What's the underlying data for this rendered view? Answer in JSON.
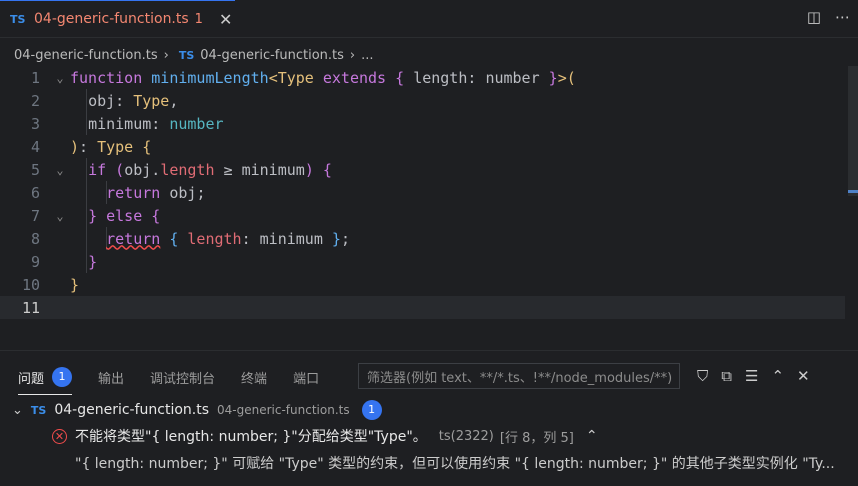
{
  "tab": {
    "badge": "TS",
    "title": "04-generic-function.ts",
    "count": "1",
    "close": "✕"
  },
  "actions": {
    "split": "◫",
    "more": "⋯"
  },
  "breadcrumb": {
    "file": "04-generic-function.ts",
    "sep": "›",
    "badge": "TS",
    "file2": "04-generic-function.ts",
    "ellipsis": "..."
  },
  "editor": {
    "lines": [
      "1",
      "2",
      "3",
      "4",
      "5",
      "6",
      "7",
      "8",
      "9",
      "10",
      "11"
    ],
    "fold": "⌄",
    "code": {
      "l1_kw": "function",
      "l1_fn": "minimumLength",
      "l1_lt": "<",
      "l1_ty": "Type",
      "l1_ext": "extends",
      "l1_ob": "{",
      "l1_len": "length",
      "l1_colon": ":",
      "l1_num": "number",
      "l1_cb": "}",
      "l1_gt": ">",
      "l1_op": "(",
      "l2_obj": "obj",
      "l2_colon": ":",
      "l2_ty": "Type",
      "l2_comma": ",",
      "l3_min": "minimum",
      "l3_colon": ":",
      "l3_num": "number",
      "l4_cp": ")",
      "l4_colon": ":",
      "l4_ty": "Type",
      "l4_ob": "{",
      "l5_if": "if",
      "l5_op": "(",
      "l5_obj": "obj",
      "l5_dot": ".",
      "l5_len": "length",
      "l5_ge": "≥",
      "l5_min": "minimum",
      "l5_cp": ")",
      "l5_ob": "{",
      "l6_ret": "return",
      "l6_obj": "obj",
      "l6_semi": ";",
      "l7_cb": "}",
      "l7_else": "else",
      "l7_ob": "{",
      "l8_ret": "return",
      "l8_ob": "{",
      "l8_len": "length",
      "l8_colon": ":",
      "l8_min": "minimum",
      "l8_cb": "}",
      "l8_semi": ";",
      "l9_cb": "}",
      "l10_cb": "}"
    }
  },
  "panel": {
    "tabs": [
      {
        "label": "问题",
        "badge": "1"
      },
      {
        "label": "输出"
      },
      {
        "label": "调试控制台"
      },
      {
        "label": "终端"
      },
      {
        "label": "端口"
      }
    ],
    "filter_placeholder": "筛选器(例如 text、**/*.ts、!**/node_modules/**)",
    "icons": {
      "filter": "⛉",
      "collapse": "⧉",
      "list": "☰",
      "up": "⌃",
      "close": "✕"
    },
    "group": {
      "chevron": "⌄",
      "badge": "TS",
      "file": "04-generic-function.ts",
      "path": "04-generic-function.ts",
      "count": "1"
    },
    "error": {
      "icon": "✕",
      "message": "不能将类型\"{ length: number; }\"分配给类型\"Type\"。",
      "code": "ts(2322)",
      "loc": "[行 8，列 5]",
      "chevron": "⌃"
    },
    "detail": "\"{ length: number; }\" 可赋给 \"Type\" 类型的约束，但可以使用约束 \"{ length: number; }\" 的其他子类型实例化 \"Ty..."
  }
}
